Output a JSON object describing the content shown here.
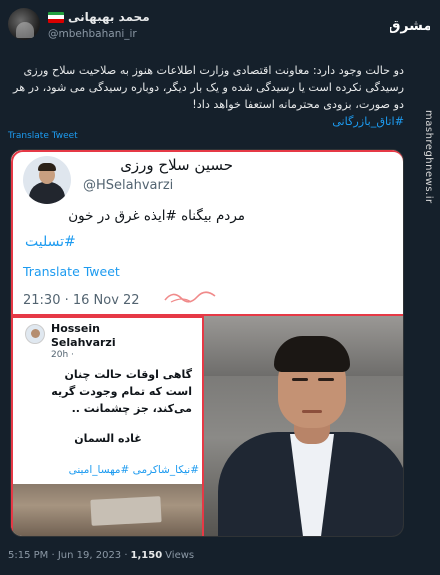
{
  "author": {
    "name": "محمد بهبهانی",
    "handle": "@mbehbahani_ir",
    "flag_colors": [
      "#239f40",
      "#ffffff",
      "#da0000"
    ]
  },
  "brand": {
    "logo_text": "مشرق",
    "side_url": "mashreghnews.ir"
  },
  "tweet": {
    "text": "دو حالت وجود دارد: معاونت اقتصادی وزارت اطلاعات هنوز به صلاحیت سلاح ورزی رسیدگی نکرده است یا رسیدگی شده و یک بار دیگر، دوباره رسیدگی می شود، در هر دو صورت، بزودی محترمانه استعفا خواهد داد!",
    "hashtag": "#اتاق_بازرگانی",
    "translate_label": "Translate Tweet"
  },
  "embedded_card_1": {
    "name": "حسین سلاح ورزی",
    "handle": "@HSelahvarzi",
    "text": "مردم بیگناه #ایذه غرق در خون",
    "hashtag": "#تسلیت",
    "translate_label": "Translate Tweet",
    "timestamp": "21:30 · 16 Nov 22"
  },
  "embedded_card_2": {
    "name": "Hossein Selahvarzi",
    "time": "20h ·",
    "body": "گاهی اوقات حالت چنان است که تمام وجودت گریه می‌کند، جز چشمانت ..",
    "signature": "غاده السمان",
    "hashtags": "#نیکا_شاکرمی #مهسا_امینی"
  },
  "footer": {
    "time": "5:15 PM · Jun 19, 2023 ·",
    "views_count": "1,150",
    "views_label": "Views"
  },
  "colors": {
    "background": "#15202b",
    "link": "#1d9bf0",
    "accent_red": "#e63946"
  }
}
